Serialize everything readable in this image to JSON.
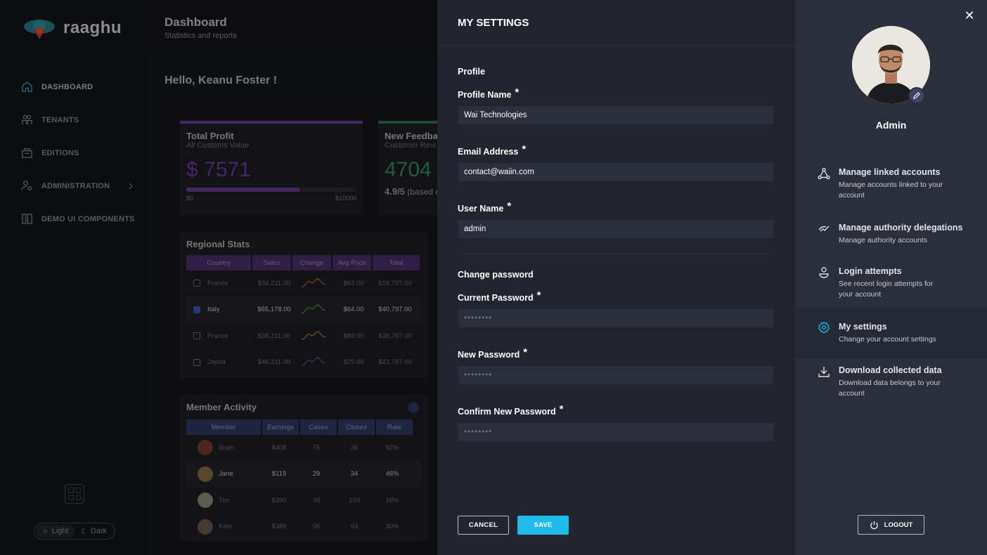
{
  "app": {
    "brand": "raaghu",
    "topbar": {
      "title": "Dashboard",
      "subtitle": "Statistics and reports"
    },
    "greeting": "Hello, Keanu Foster !",
    "nav": [
      {
        "label": "DASHBOARD",
        "icon": "home-icon"
      },
      {
        "label": "TENANTS",
        "icon": "users-icon"
      },
      {
        "label": "EDITIONS",
        "icon": "editions-icon"
      },
      {
        "label": "ADMINISTRATION",
        "icon": "admin-icon"
      },
      {
        "label": "DEMO UI COMPONENTS",
        "icon": "components-icon"
      }
    ],
    "theme": {
      "light": "Light",
      "dark": "Dark"
    },
    "profit_card": {
      "title": "Total Profit",
      "subtitle": "All Customs Value",
      "value": "$ 7571",
      "progress": 0.67,
      "min": "$0",
      "max": "$10000"
    },
    "feedback_card": {
      "title": "New Feedbac",
      "subtitle": "Customer Revi",
      "value": "4704",
      "rating": "4.9/5",
      "note": "(based c"
    },
    "regional": {
      "title": "Regional Stats",
      "headers": [
        "Country",
        "Sales",
        "Change",
        "Avg Price",
        "Total"
      ],
      "rows": [
        {
          "country": "France",
          "sales": "$34,211.00",
          "avg": "$63.00",
          "total": "$16,797.00",
          "checked": false,
          "spark": "#c0602c"
        },
        {
          "country": "Italy",
          "sales": "$65,178.00",
          "avg": "$64.00",
          "total": "$40,797.00",
          "checked": true,
          "spark": "#3f8f4f"
        },
        {
          "country": "France",
          "sales": "$38,211.00",
          "avg": "$89.00",
          "total": "$39,797.00",
          "checked": false,
          "spark": "#a07a20"
        },
        {
          "country": "Japna",
          "sales": "$46,211.00",
          "avg": "$25.00",
          "total": "$22,797.00",
          "checked": false,
          "spark": "#4d5a8a"
        }
      ]
    },
    "member": {
      "title": "Member Activity",
      "headers": [
        "Member",
        "Earnings",
        "Cases",
        "Closed",
        "Rate"
      ],
      "rows": [
        {
          "name": "Brain",
          "earnings": "$408",
          "cases": "75",
          "closed": "36",
          "rate": "92%"
        },
        {
          "name": "Jane",
          "earnings": "$119",
          "cases": "29",
          "closed": "34",
          "rate": "46%"
        },
        {
          "name": "Tim",
          "earnings": "$390",
          "cases": "38",
          "closed": "104",
          "rate": "16%"
        },
        {
          "name": "Kate",
          "earnings": "$389",
          "cases": "96",
          "closed": "93",
          "rate": "30%"
        }
      ]
    }
  },
  "settings": {
    "title": "MY SETTINGS",
    "profile_section": "Profile",
    "profile_name": {
      "label": "Profile Name",
      "value": "Wai Technologies"
    },
    "email": {
      "label": "Email Address",
      "value": "contact@waiin.com"
    },
    "username": {
      "label": "User Name",
      "value": "admin"
    },
    "password_section": "Change password",
    "current_password": {
      "label": "Current Password",
      "placeholder": "••••••••"
    },
    "new_password": {
      "label": "New Password",
      "placeholder": "••••••••"
    },
    "confirm_password": {
      "label": "Confirm New Password",
      "placeholder": "••••••••"
    },
    "required_mark": "*",
    "cancel_label": "CANCEL",
    "save_label": "SAVE",
    "accent": "#1fb9ea"
  },
  "account": {
    "close": "✕",
    "name": "Admin",
    "menu": [
      {
        "title": "Manage linked accounts",
        "desc": "Manage accounts linked to your account",
        "icon": "linked-accounts-icon"
      },
      {
        "title": "Manage authority delegations",
        "desc": "Manage authority accounts",
        "icon": "delegation-icon"
      },
      {
        "title": "Login attempts",
        "desc": "See recent login attempts for your account",
        "icon": "login-attempts-icon"
      },
      {
        "title": "My settings",
        "desc": "Change your account settings",
        "icon": "settings-gear-icon"
      },
      {
        "title": "Download collected data",
        "desc": "Download data belongs to your account",
        "icon": "download-icon"
      }
    ],
    "logout_label": "LOGOUT"
  }
}
